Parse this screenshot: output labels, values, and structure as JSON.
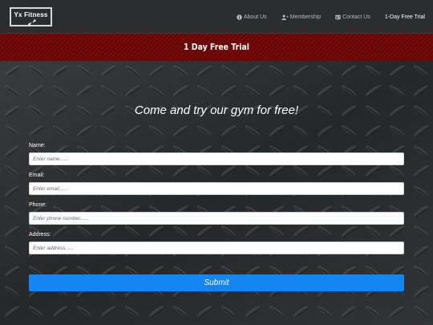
{
  "navbar": {
    "brand": "Yx Fitness",
    "items": [
      {
        "label": "About Us",
        "icon": "info-icon",
        "active": false
      },
      {
        "label": "Membership",
        "icon": "user-plus-icon",
        "active": false
      },
      {
        "label": "Contact Us",
        "icon": "contact-card-icon",
        "active": false
      },
      {
        "label": "1-Day Free Trial",
        "icon": "",
        "active": true
      }
    ]
  },
  "banner": {
    "title": "1 Day Free Trial"
  },
  "form": {
    "headline": "Come and try our gym for free!",
    "fields": [
      {
        "label": "Name:",
        "placeholder": "Enter name......",
        "required": "*"
      },
      {
        "label": "Email:",
        "placeholder": "Enter email......",
        "required": "*"
      },
      {
        "label": "Phone:",
        "placeholder": "Enter phone number......",
        "required": "*"
      },
      {
        "label": "Address:",
        "placeholder": "Enter address......",
        "required": "*"
      }
    ],
    "submit_label": "Submit"
  },
  "colors": {
    "navbar_bg": "#2c2d2f",
    "banner_bg": "#7a0a0a",
    "submit_bg": "#1386f2",
    "required_marker": "#d61b1b"
  }
}
